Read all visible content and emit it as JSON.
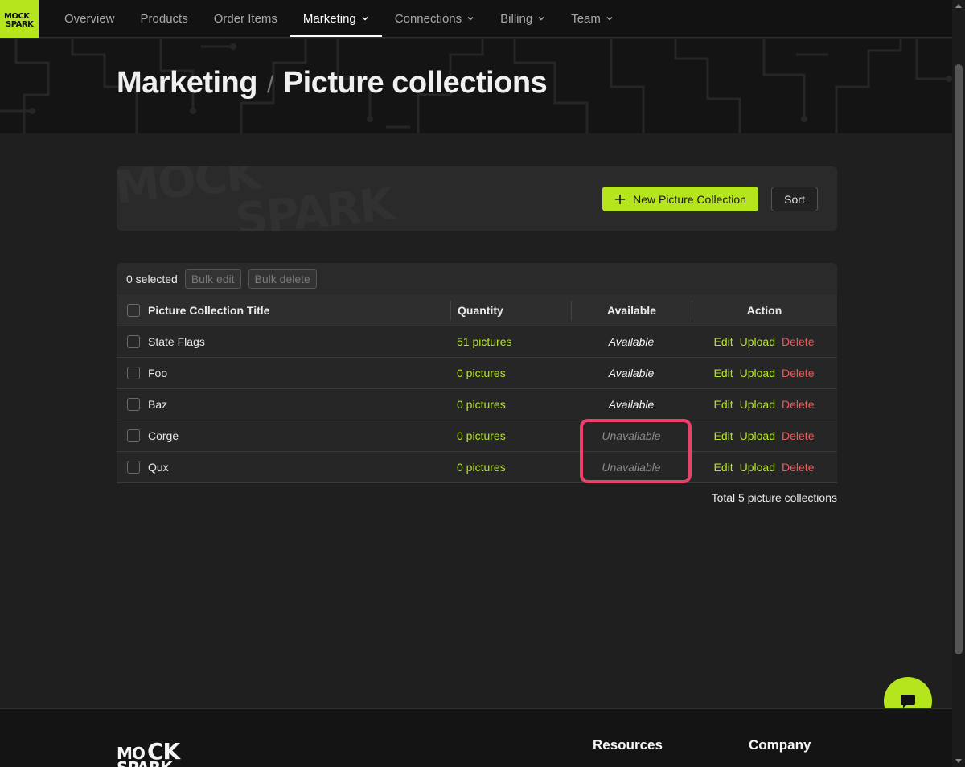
{
  "nav": {
    "logo_text": "MOCK SPARK",
    "items": [
      {
        "label": "Overview"
      },
      {
        "label": "Products"
      },
      {
        "label": "Order Items"
      },
      {
        "label": "Marketing"
      },
      {
        "label": "Connections"
      },
      {
        "label": "Billing"
      },
      {
        "label": "Team"
      }
    ]
  },
  "breadcrumb": {
    "parent": "Marketing",
    "separator": "/",
    "current": "Picture collections"
  },
  "toolbar": {
    "new_label": "New Picture Collection",
    "sort_label": "Sort"
  },
  "bulk": {
    "selected_text": "0 selected",
    "edit_label": "Bulk edit",
    "delete_label": "Bulk delete"
  },
  "table": {
    "headers": {
      "title": "Picture Collection Title",
      "quantity": "Quantity",
      "available": "Available",
      "action": "Action"
    },
    "rows": [
      {
        "title": "State Flags",
        "quantity": "51 pictures",
        "available": "Available"
      },
      {
        "title": "Foo",
        "quantity": "0 pictures",
        "available": "Available"
      },
      {
        "title": "Baz",
        "quantity": "0 pictures",
        "available": "Available"
      },
      {
        "title": "Corge",
        "quantity": "0 pictures",
        "available": "Unavailable"
      },
      {
        "title": "Qux",
        "quantity": "0 pictures",
        "available": "Unavailable"
      }
    ],
    "actions": {
      "edit": "Edit",
      "upload": "Upload",
      "delete": "Delete"
    }
  },
  "total_text": "Total 5 picture collections",
  "footer": {
    "logo_text": "MOCK SPARK",
    "resources": "Resources",
    "company": "Company"
  },
  "colors": {
    "accent": "#b5e61d",
    "danger": "#ee5a5a",
    "highlight": "#e8416a"
  }
}
